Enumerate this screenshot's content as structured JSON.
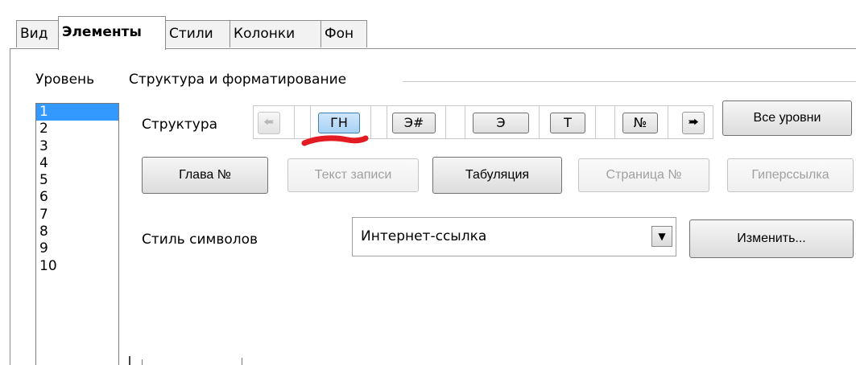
{
  "tabs": [
    {
      "label": "Вид",
      "active": false
    },
    {
      "label": "Элементы",
      "active": true
    },
    {
      "label": "Стили",
      "active": false
    },
    {
      "label": "Колонки",
      "active": false
    },
    {
      "label": "Фон",
      "active": false
    }
  ],
  "level_label": "Уровень",
  "section_label": "Структура и форматирование",
  "levels": [
    "1",
    "2",
    "3",
    "4",
    "5",
    "6",
    "7",
    "8",
    "9",
    "10"
  ],
  "selected_level": "1",
  "structure": {
    "label": "Структура",
    "tokens": [
      "ГН",
      "Э#",
      "Э",
      "Т",
      "№"
    ],
    "active_token": "ГН",
    "prev_icon": "arrow-left-icon",
    "next_icon": "arrow-right-icon",
    "all_levels_button": "Все уровни"
  },
  "buttons": {
    "chapter_no": "Глава №",
    "entry_text": "Текст записи",
    "tab_stop": "Табуляция",
    "page_no": "Страница №",
    "hyperlink": "Гиперссылка"
  },
  "char_style": {
    "label": "Стиль символов",
    "value": "Интернет-ссылка",
    "edit_button": "Изменить..."
  },
  "colors": {
    "selection": "#3399ff",
    "annotation": "#e31b23"
  }
}
